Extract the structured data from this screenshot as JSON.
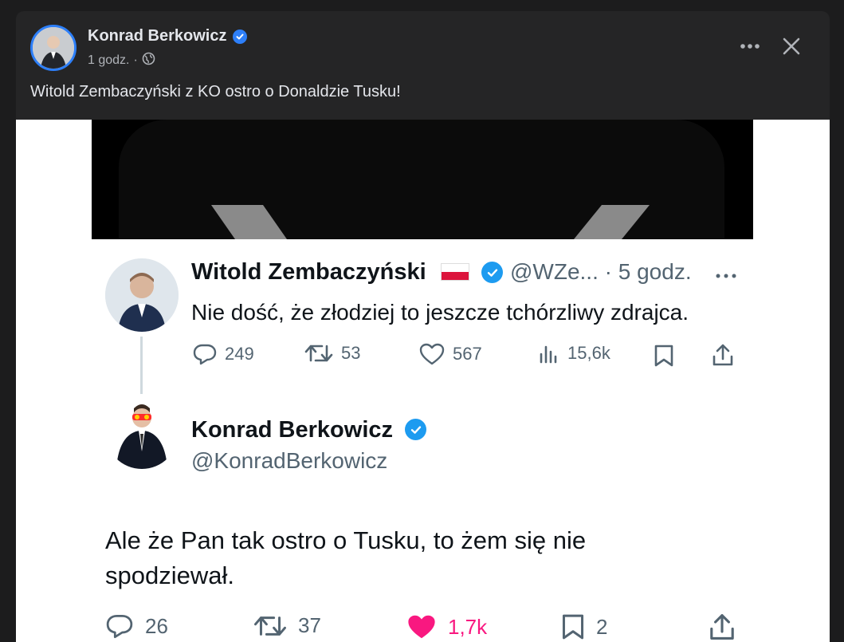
{
  "post": {
    "author": "Konrad Berkowicz",
    "time": "1 godz.",
    "caption": "Witold Zembaczyński z KO ostro o Donaldzie Tusku!"
  },
  "tweet1": {
    "name": "Witold Zembaczyński",
    "handle_time": "@WZe... · 5 godz.",
    "text": "Nie dość, że złodziej to jeszcze tchórzliwy zdrajca.",
    "replies": "249",
    "retweets": "53",
    "likes": "567",
    "views": "15,6k"
  },
  "tweet2": {
    "name": "Konrad Berkowicz",
    "handle": "@KonradBerkowicz",
    "text_line1": "Ale że Pan tak ostro o Tusku, to żem się nie",
    "text_line2": "spodziewał.",
    "replies": "26",
    "retweets": "37",
    "likes": "1,7k",
    "bookmarks": "2"
  },
  "icons": {
    "verified": "verified-badge-icon",
    "globe": "globe-icon",
    "more": "more-options-icon",
    "close": "close-icon",
    "reply": "reply-icon",
    "retweet": "retweet-icon",
    "like": "heart-icon",
    "views": "views-icon",
    "bookmark": "bookmark-icon",
    "share": "share-icon"
  },
  "colors": {
    "facebook_verified": "#2d7ff9",
    "twitter_verified": "#1d9bf0",
    "liked": "#f91880",
    "muted": "#536471"
  }
}
